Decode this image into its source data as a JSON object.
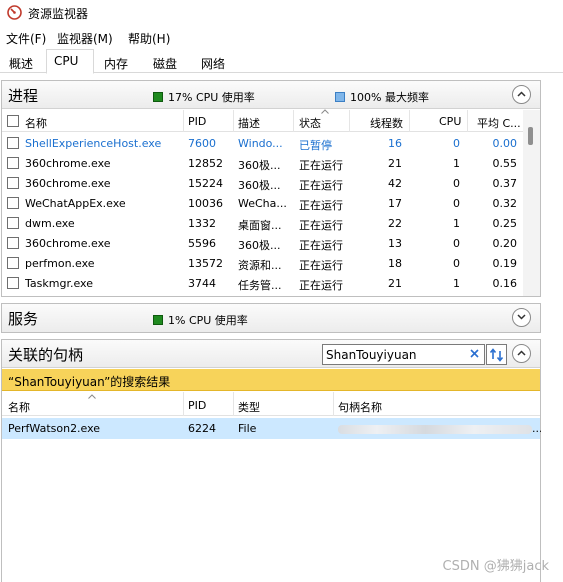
{
  "window": {
    "title": "资源监视器"
  },
  "menu": [
    "文件(F)",
    "监视器(M)",
    "帮助(H)"
  ],
  "tabs": [
    {
      "label": "概述",
      "active": false
    },
    {
      "label": "CPU",
      "active": true
    },
    {
      "label": "内存",
      "active": false
    },
    {
      "label": "磁盘",
      "active": false
    },
    {
      "label": "网络",
      "active": false
    }
  ],
  "processes": {
    "title": "进程",
    "cpu_usage": "17% CPU 使用率",
    "max_freq": "100% 最大频率",
    "columns": [
      "名称",
      "PID",
      "描述",
      "状态",
      "线程数",
      "CPU",
      "平均 C..."
    ],
    "rows": [
      {
        "name": "ShellExperienceHost.exe",
        "pid": "7600",
        "desc": "Windo...",
        "status": "已暂停",
        "threads": "16",
        "cpu": "0",
        "avg": "0.00",
        "suspended": true
      },
      {
        "name": "360chrome.exe",
        "pid": "12852",
        "desc": "360极...",
        "status": "正在运行",
        "threads": "21",
        "cpu": "1",
        "avg": "0.55",
        "suspended": false
      },
      {
        "name": "360chrome.exe",
        "pid": "15224",
        "desc": "360极...",
        "status": "正在运行",
        "threads": "42",
        "cpu": "0",
        "avg": "0.37",
        "suspended": false
      },
      {
        "name": "WeChatAppEx.exe",
        "pid": "10036",
        "desc": "WeCha...",
        "status": "正在运行",
        "threads": "17",
        "cpu": "0",
        "avg": "0.32",
        "suspended": false
      },
      {
        "name": "dwm.exe",
        "pid": "1332",
        "desc": "桌面窗...",
        "status": "正在运行",
        "threads": "22",
        "cpu": "1",
        "avg": "0.25",
        "suspended": false
      },
      {
        "name": "360chrome.exe",
        "pid": "5596",
        "desc": "360极...",
        "status": "正在运行",
        "threads": "13",
        "cpu": "0",
        "avg": "0.20",
        "suspended": false
      },
      {
        "name": "perfmon.exe",
        "pid": "13572",
        "desc": "资源和...",
        "status": "正在运行",
        "threads": "18",
        "cpu": "0",
        "avg": "0.19",
        "suspended": false
      },
      {
        "name": "Taskmgr.exe",
        "pid": "3744",
        "desc": "任务管...",
        "status": "正在运行",
        "threads": "21",
        "cpu": "1",
        "avg": "0.16",
        "suspended": false
      }
    ]
  },
  "services": {
    "title": "服务",
    "cpu_usage": "1% CPU 使用率"
  },
  "handles": {
    "title": "关联的句柄",
    "search_value": "ShanTouyiyuan",
    "result_label": "“ShanTouyiyuan”的搜索结果",
    "columns": [
      "名称",
      "PID",
      "类型",
      "句柄名称"
    ],
    "rows": [
      {
        "name": "PerfWatson2.exe",
        "pid": "6224",
        "type": "File",
        "handle_tail": "..."
      }
    ]
  },
  "watermark": "CSDN @狒狒jack",
  "colors": {
    "accent_green": "#1f8a1f",
    "accent_blue": "#7fb6ea",
    "result_bar": "#f7d35a",
    "selected_row": "#cce8ff",
    "suspended_text": "#1a6fcf"
  }
}
